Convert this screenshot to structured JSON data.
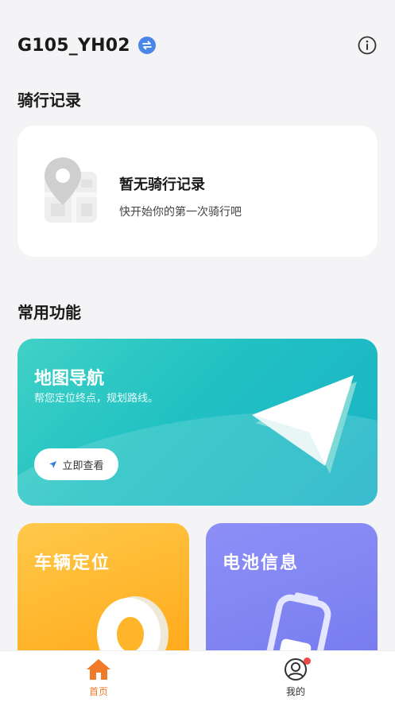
{
  "header": {
    "device_name": "G105_YH02",
    "switch_icon": "swap-icon",
    "info_icon": "info-circle-icon"
  },
  "ride_section": {
    "title": "骑行记录",
    "empty_title": "暂无骑行记录",
    "empty_subtitle": "快开始你的第一次骑行吧"
  },
  "functions_section": {
    "title": "常用功能",
    "map_nav": {
      "title": "地图导航",
      "subtitle": "帮您定位终点，规划路线。",
      "button_label": "立即查看"
    },
    "vehicle_locate": {
      "title": "车辆定位"
    },
    "battery_info": {
      "title": "电池信息"
    }
  },
  "tabbar": {
    "home_label": "首页",
    "mine_label": "我的"
  },
  "colors": {
    "accent_orange": "#f07a28",
    "nav_teal": "#21c1c3",
    "locate_yellow": "#ffb42a",
    "battery_purple": "#7f84f2",
    "switch_blue": "#4a86e8"
  }
}
